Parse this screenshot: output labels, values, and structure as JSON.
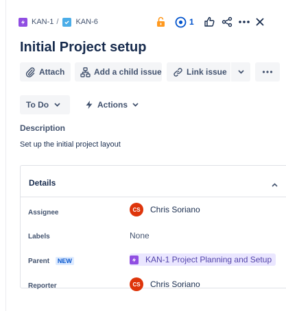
{
  "breadcrumb": {
    "parent_key": "KAN-1",
    "separator": "/",
    "current_key": "KAN-6"
  },
  "toolbar": {
    "watch_count": "1"
  },
  "issue": {
    "title": "Initial Project setup"
  },
  "actions": {
    "attach": "Attach",
    "add_child": "Add a child issue",
    "link_issue": "Link issue"
  },
  "status": {
    "label": "To Do",
    "actions_label": "Actions"
  },
  "description": {
    "heading": "Description",
    "text": "Set up the initial project layout"
  },
  "details": {
    "heading": "Details",
    "assignee_label": "Assignee",
    "assignee_name": "Chris Soriano",
    "assignee_initials": "CS",
    "labels_label": "Labels",
    "labels_value": "None",
    "parent_label": "Parent",
    "parent_badge": "NEW",
    "parent_value": "KAN-1 Project Planning and Setup",
    "reporter_label": "Reporter",
    "reporter_name": "Chris Soriano",
    "reporter_initials": "CS"
  },
  "colors": {
    "epic": "#904ee2",
    "task": "#4bade8",
    "avatar": "#de350b",
    "lock": "#ff991f",
    "accent": "#0052cc"
  }
}
